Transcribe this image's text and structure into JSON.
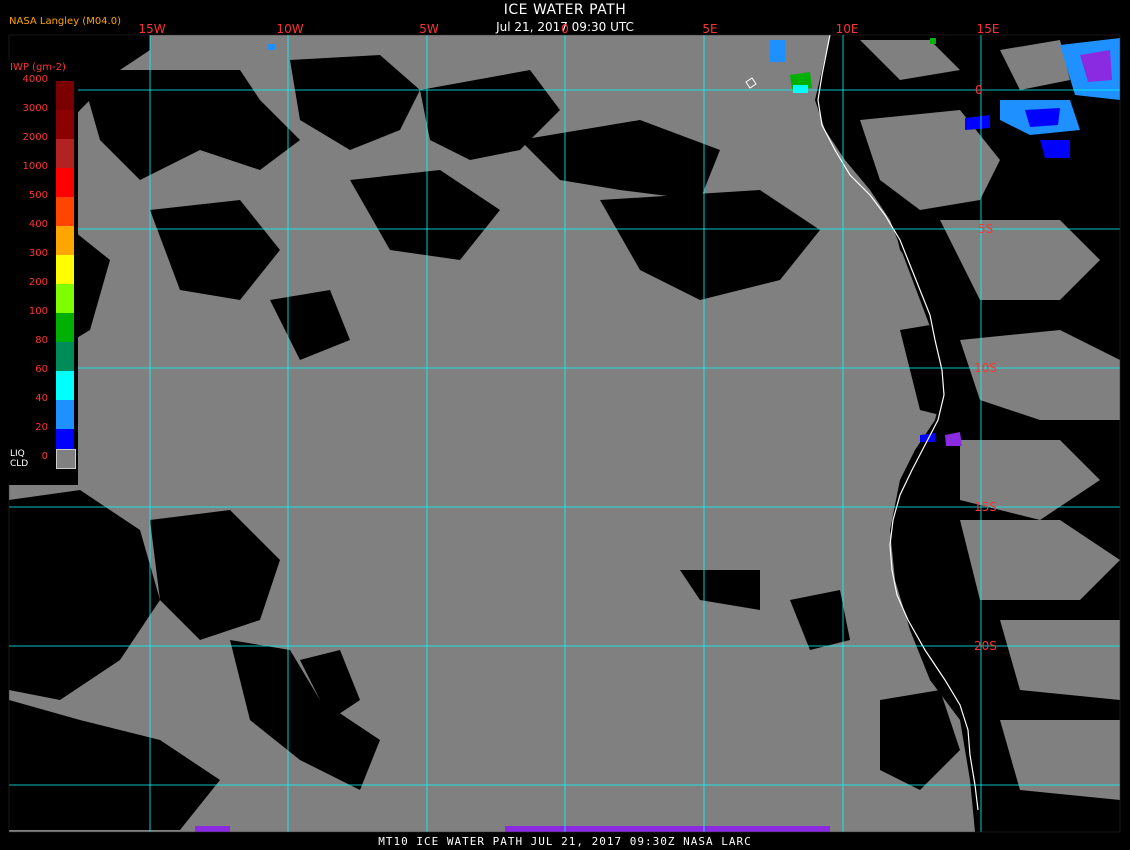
{
  "header": {
    "title": "ICE WATER PATH",
    "subtitle": "Jul 21, 2017 09:30 UTC",
    "producer": "NASA Langley (M04.0)"
  },
  "footer": {
    "text": "MT10  ICE WATER PATH   JUL 21, 2017 09:30Z   NASA LARC"
  },
  "legend": {
    "title": "IWP (gm-2)",
    "levels": [
      {
        "label": "4000",
        "color": "#7a0000"
      },
      {
        "label": "3000",
        "color": "#8b0000"
      },
      {
        "label": "2000",
        "color": "#b22222"
      },
      {
        "label": "1000",
        "color": "#ff0000"
      },
      {
        "label": "500",
        "color": "#ff4500"
      },
      {
        "label": "400",
        "color": "#ffa500"
      },
      {
        "label": "300",
        "color": "#ffff00"
      },
      {
        "label": "200",
        "color": "#7fff00"
      },
      {
        "label": "100",
        "color": "#00b000"
      },
      {
        "label": "80",
        "color": "#008b5a"
      },
      {
        "label": "60",
        "color": "#00ffff"
      },
      {
        "label": "40",
        "color": "#1e90ff"
      },
      {
        "label": "20",
        "color": "#0000ff"
      },
      {
        "label": "0",
        "color": "#8a2be2"
      }
    ],
    "liquid_cloud_label_1": "LIQ",
    "liquid_cloud_label_2": "CLD",
    "liquid_cloud_color": "#808080"
  },
  "grid": {
    "color": "#00ffff",
    "longitude_labels": [
      "15W",
      "10W",
      "5W",
      "0",
      "5E",
      "10E",
      "15E"
    ],
    "latitude_labels": [
      "0",
      "5S",
      "10S",
      "15S",
      "20S"
    ]
  },
  "colors": {
    "background": "#000000",
    "liquid_cloud": "#808080",
    "coastline": "#ffffff",
    "label": "#ff3333"
  }
}
